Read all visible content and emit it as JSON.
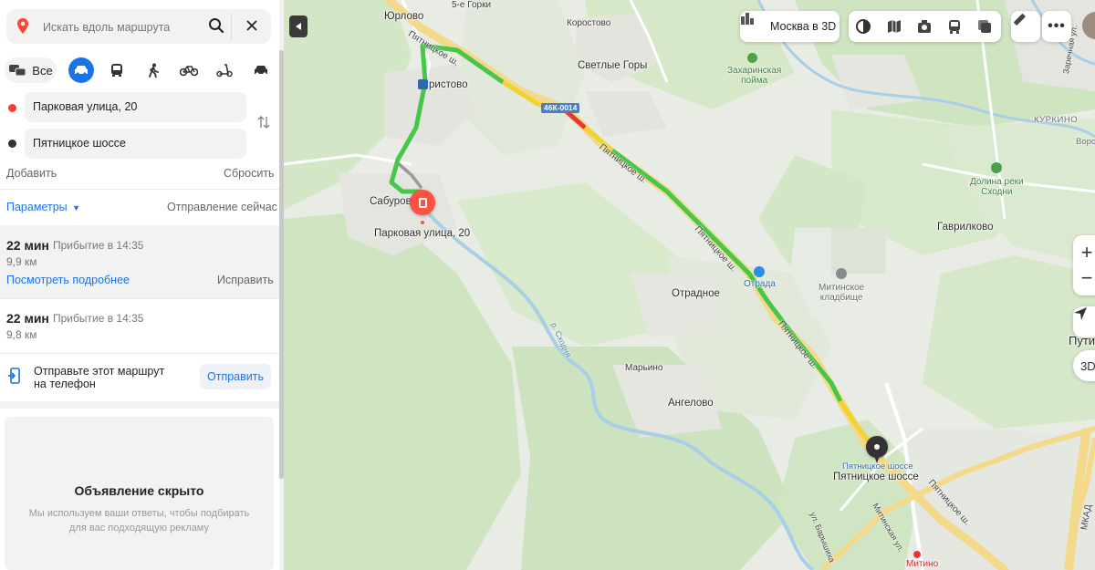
{
  "search": {
    "placeholder": "Искать вдоль маршрута"
  },
  "modes": {
    "all_label": "Все"
  },
  "route": {
    "from": "Парковая улица, 20",
    "to": "Пятницкое шоссе",
    "add": "Добавить",
    "reset": "Сбросить",
    "params": "Параметры",
    "departure": "Отправление сейчас"
  },
  "options": [
    {
      "time": "22 мин",
      "arrival": "Прибытие в 14:35",
      "distance": "9,9 км",
      "details": "Посмотреть подробнее",
      "fix": "Исправить"
    },
    {
      "time": "22 мин",
      "arrival": "Прибытие в 14:35",
      "distance": "9,8 км"
    }
  ],
  "send": {
    "text_line1": "Отправьте этот маршрут",
    "text_line2": "на телефон",
    "button": "Отправить"
  },
  "ad": {
    "title": "Объявление скрыто",
    "text_line1": "Мы используем ваши ответы, чтобы подбирать",
    "text_line2": "для вас подходящую рекламу"
  },
  "map_controls": {
    "moscow3d": "Москва в 3D",
    "btn3d": "3D"
  },
  "places": {
    "yurlovo": "Юрлово",
    "gorki": "5-е Горки",
    "korostovo": "Коростово",
    "svetlye_gory": "Светлые Горы",
    "zakharinskaya_1": "Захаринская",
    "zakharinskaya_2": "пойма",
    "aristovo": "ристово",
    "sabur": "Сабурово",
    "start_label": "Парковая улица, 20",
    "kurkino": "КУРКИНО",
    "vorot": "Ворот",
    "dolina_1": "Долина реки",
    "dolina_2": "Сходни",
    "gavrilkovo": "Гаврилково",
    "otradnoe": "Отрадное",
    "otrada": "Отрада",
    "mitin_1": "Митинское",
    "mitin_2": "кладбище",
    "putil": "Пути",
    "marino": "Марьино",
    "angelovo": "Ангелово",
    "dest_label": "Пятницкое шоссе",
    "dest_sub": "Пятницкое шоссе",
    "mitino": "Митино",
    "mkad": "МКАД",
    "shosse_top": "Пятницкое ш.",
    "shosse_mid1": "Пятницкое ш.",
    "shosse_mid2": "Пятницкое ш.",
    "shosse_low": "Пятницкое ш.",
    "shosse_bottom": "Пятницкое ш.",
    "skhodnya": "р. Сходня",
    "zelenaya": "Заречная ул.",
    "mitinskaya": "Митинская ул.",
    "barysh": "ул. Барышиха",
    "road_badge": "46К-0014"
  },
  "colors": {
    "accent": "#1a73e8",
    "route_green": "#3fc43f",
    "route_yellow": "#f1d22e",
    "route_red": "#e53935",
    "pin_red": "#ff5140"
  }
}
